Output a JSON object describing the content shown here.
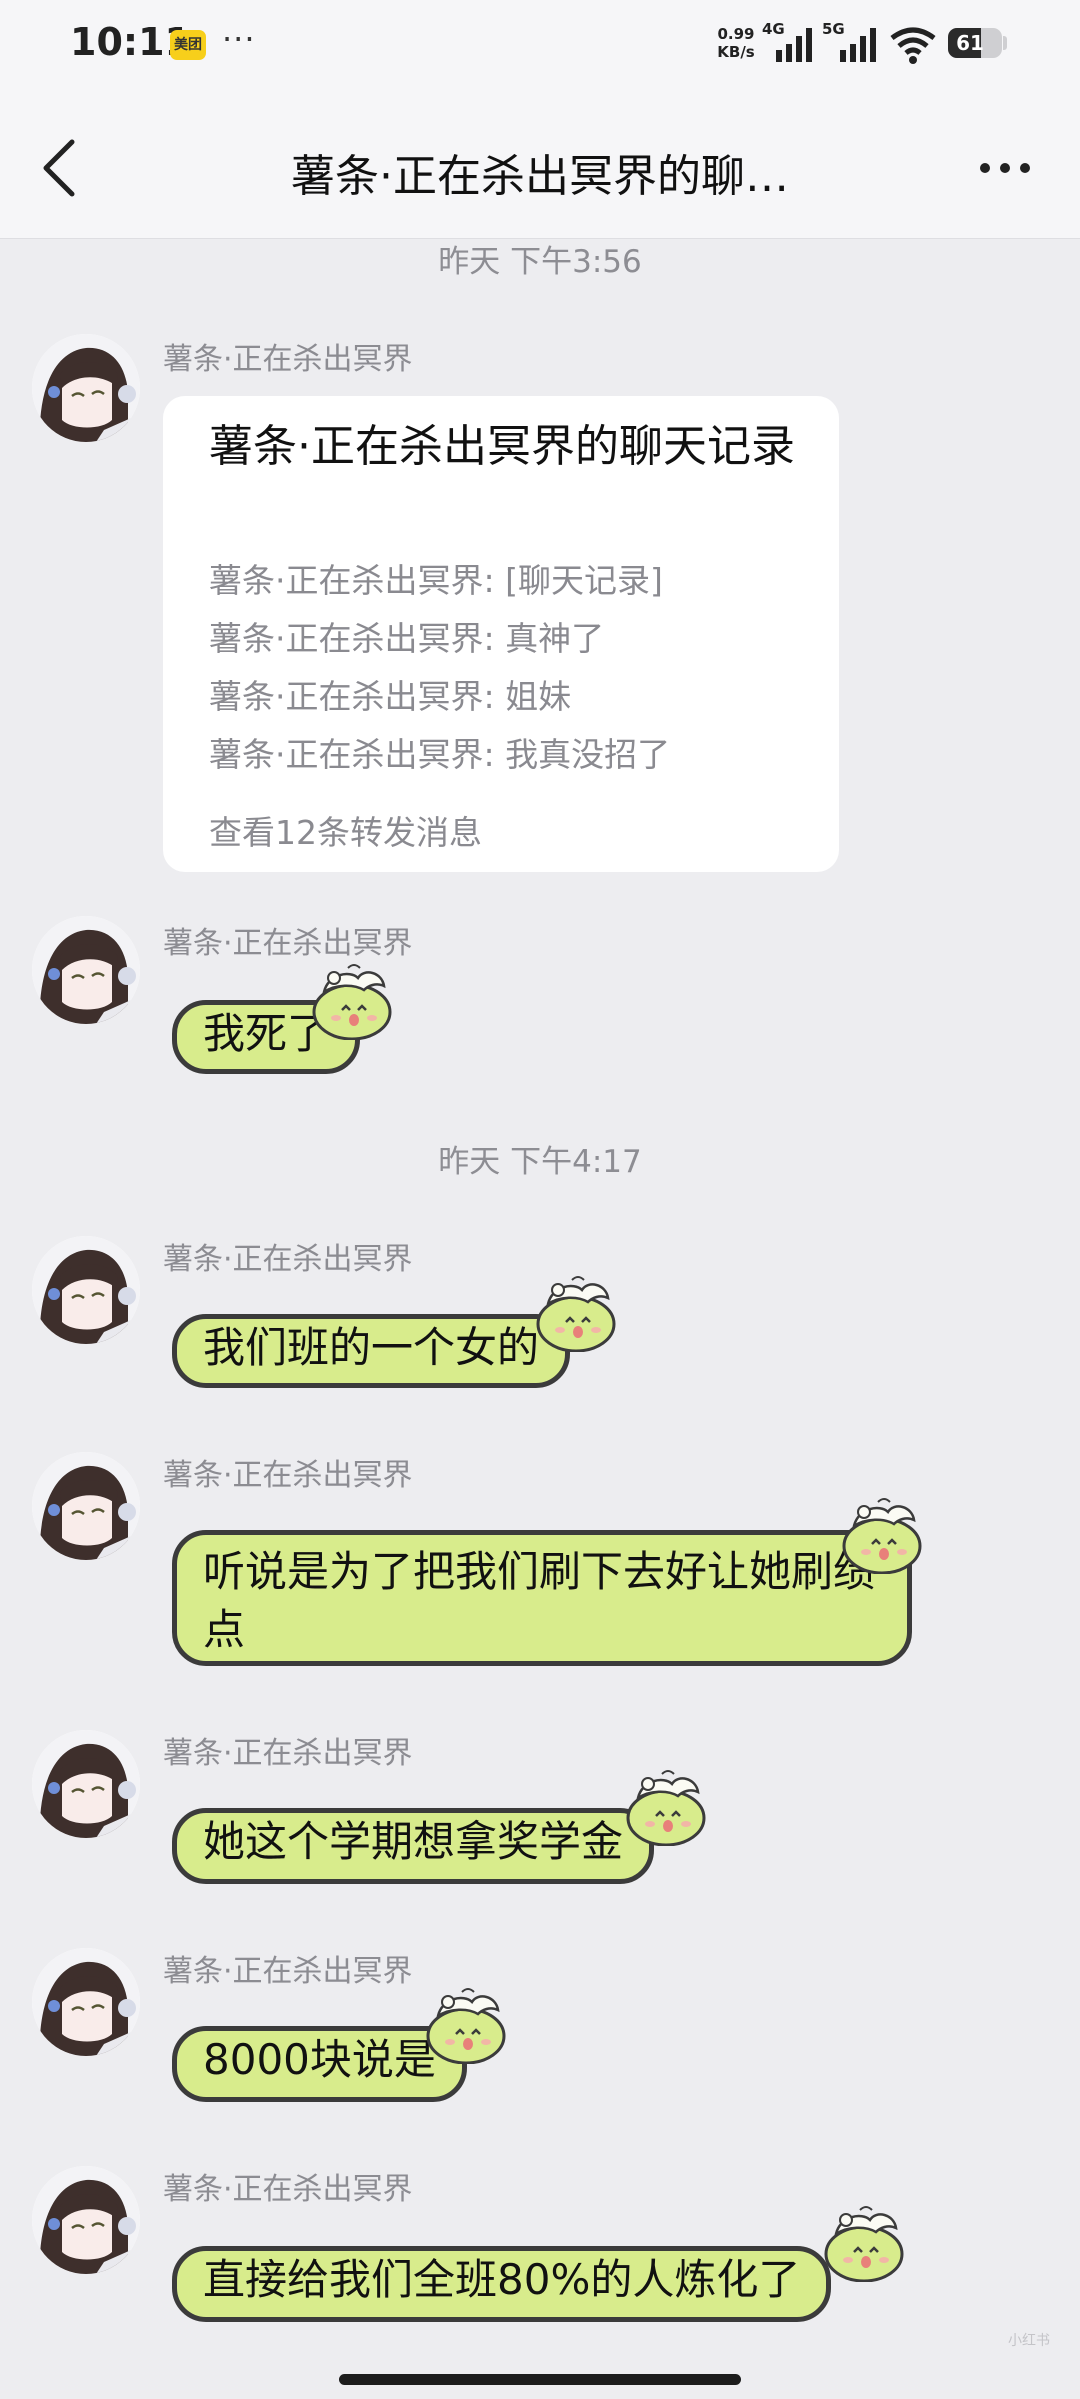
{
  "status_bar": {
    "time": "10:11",
    "app_badge": "美团",
    "more": "···",
    "net_speed_value": "0.99",
    "net_speed_unit": "KB/s",
    "sim1_type": "4G",
    "sim2_type": "5G",
    "battery_level": "61",
    "battery_fraction": 0.61
  },
  "header": {
    "title": "薯条·正在杀出冥界的聊…"
  },
  "chat": {
    "timestamp1": "昨天 下午3:56",
    "timestamp2": "昨天 下午4:17",
    "sender_name": "薯条·正在杀出冥界",
    "forward_card": {
      "title": "薯条·正在杀出冥界的聊天记录",
      "lines": [
        "薯条·正在杀出冥界: [聊天记录]",
        "薯条·正在杀出冥界: 真神了",
        "薯条·正在杀出冥界: 姐妹",
        "薯条·正在杀出冥界: 我真没招了"
      ],
      "footer": "查看12条转发消息"
    },
    "messages": [
      "我死了",
      "我们班的一个女的",
      "听说是为了把我们刷下去好让她刷绩点",
      "她这个学期想拿奖学金",
      "8000块说是",
      "直接给我们全班80%的人炼化了"
    ]
  },
  "watermark": "小红书",
  "colors": {
    "bubble": "#d8ec8c",
    "bubble_border": "#3b3b3b",
    "chat_bg": "#ededf0"
  }
}
